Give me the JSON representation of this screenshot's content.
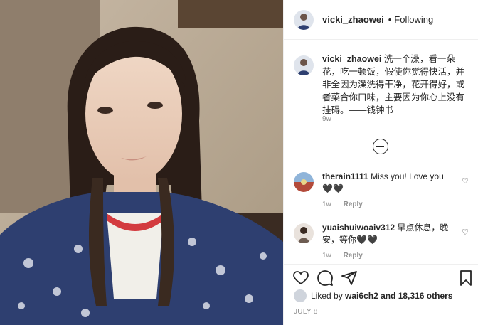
{
  "post": {
    "username": "vicki_zhaowei",
    "separator": "•",
    "follow_status": "Following",
    "caption": "洗一个澡，看一朵花，吃一顿饭，假使你觉得快活，并非全因为澡洗得干净，花开得好，或者菜合你口味，主要因为你心上没有挂碍。——钱钟书",
    "caption_age": "9w",
    "likes_prefix": "Liked by",
    "liked_by_user": "wai6ch2",
    "likes_suffix": "and 18,316 others",
    "date": "JULY 8"
  },
  "comments": [
    {
      "username": "therain1111",
      "text": "Miss you! Love you 🖤🖤",
      "age": "1w",
      "reply_label": "Reply"
    },
    {
      "username": "yuaishuiwoaiv312",
      "text": "早点休息，晚安，等你🖤🖤",
      "age": "1w",
      "reply_label": "Reply"
    }
  ],
  "icons": {
    "more": "more-options-icon",
    "load_more": "load-more-comments-icon",
    "like": "heart-icon",
    "comment": "comment-bubble-icon",
    "share": "paper-plane-icon",
    "save": "bookmark-icon"
  },
  "colors": {
    "text": "#262626",
    "secondary": "#8e8e8e",
    "border": "#efefef"
  }
}
